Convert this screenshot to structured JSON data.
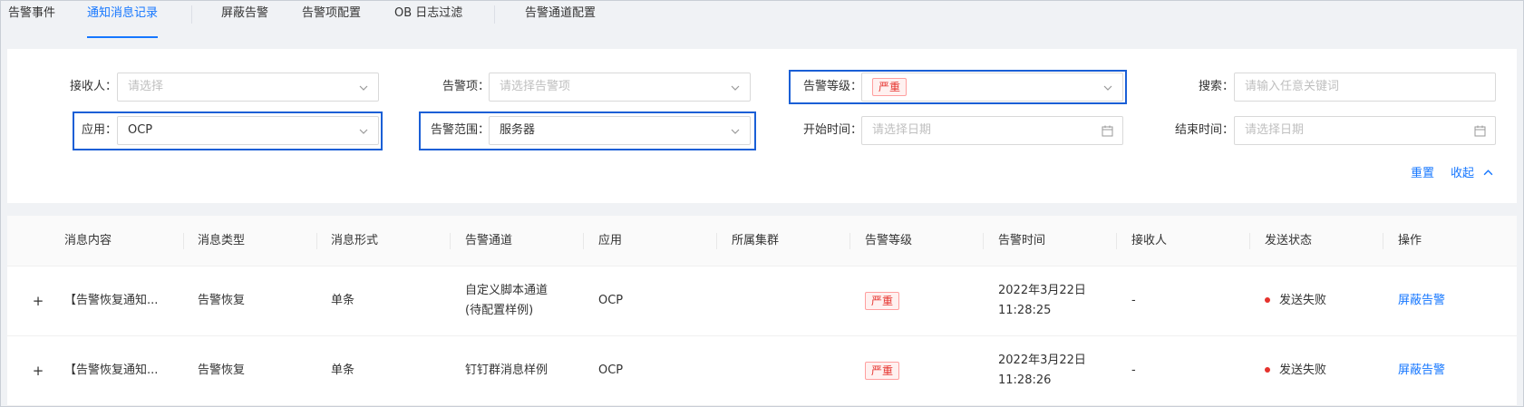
{
  "tabs": [
    {
      "label": "告警事件",
      "active": false
    },
    {
      "label": "通知消息记录",
      "active": true
    },
    {
      "label": "屏蔽告警",
      "active": false
    },
    {
      "label": "告警项配置",
      "active": false
    },
    {
      "label": "OB 日志过滤",
      "active": false
    },
    {
      "label": "告警通道配置",
      "active": false
    }
  ],
  "filters": {
    "receiver": {
      "label": "接收人：",
      "placeholder": "请选择"
    },
    "alarm_item": {
      "label": "告警项：",
      "placeholder": "请选择告警项"
    },
    "alarm_level": {
      "label": "告警等级：",
      "value": "严重"
    },
    "search": {
      "label": "搜索：",
      "placeholder": "请输入任意关键词"
    },
    "app": {
      "label": "应用：",
      "value": "OCP"
    },
    "alarm_scope": {
      "label": "告警范围：",
      "value": "服务器"
    },
    "start_time": {
      "label": "开始时间：",
      "placeholder": "请选择日期"
    },
    "end_time": {
      "label": "结束时间：",
      "placeholder": "请选择日期"
    },
    "reset_label": "重置",
    "collapse_label": "收起"
  },
  "table": {
    "columns": [
      "消息内容",
      "消息类型",
      "消息形式",
      "告警通道",
      "应用",
      "所属集群",
      "告警等级",
      "告警时间",
      "接收人",
      "发送状态",
      "操作"
    ],
    "rows": [
      {
        "expand": "+",
        "content": "【告警恢复通知...",
        "type": "告警恢复",
        "form": "单条",
        "channel_line1": "自定义脚本通道",
        "channel_line2": "(待配置样例)",
        "app": "OCP",
        "cluster": "",
        "level": "严重",
        "time_line1": "2022年3月22日",
        "time_line2": "11:28:25",
        "receiver": "-",
        "status": "发送失败",
        "action": "屏蔽告警"
      },
      {
        "expand": "+",
        "content": "【告警恢复通知...",
        "type": "告警恢复",
        "form": "单条",
        "channel_line1": "钉钉群消息样例",
        "channel_line2": "",
        "app": "OCP",
        "cluster": "",
        "level": "严重",
        "time_line1": "2022年3月22日",
        "time_line2": "11:28:26",
        "receiver": "-",
        "status": "发送失败",
        "action": "屏蔽告警"
      }
    ]
  },
  "colors": {
    "accent": "#1677ff",
    "highlight_box": "#1a5fd6",
    "danger": "#e5322d"
  },
  "icons": {
    "select_arrow": "chevron-down-icon",
    "date": "calendar-icon",
    "collapse": "chevron-up-icon",
    "status": "status-dot-icon"
  }
}
